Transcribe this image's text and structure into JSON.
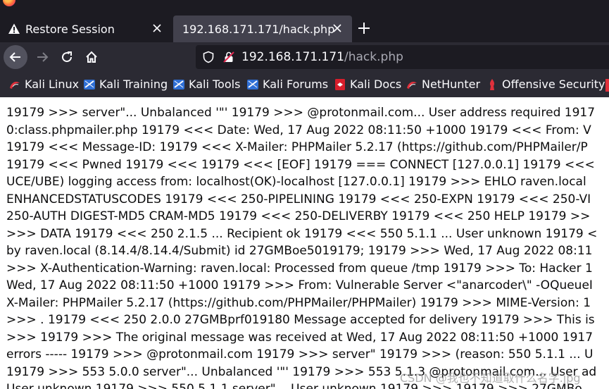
{
  "tabs": [
    {
      "label": "Restore Session",
      "icon": "warning-icon",
      "active": false
    },
    {
      "label": "192.168.171.171/hack.php",
      "active": true
    }
  ],
  "nav": {
    "url_host": "192.168.171.171",
    "url_path": "/hack.php"
  },
  "bookmarks": [
    {
      "label": "Kali Linux",
      "icon": "kali-linux-icon"
    },
    {
      "label": "Kali Training",
      "icon": "kali-training-icon"
    },
    {
      "label": "Kali Tools",
      "icon": "kali-tools-icon"
    },
    {
      "label": "Kali Forums",
      "icon": "kali-forums-icon"
    },
    {
      "label": "Kali Docs",
      "icon": "kali-docs-icon"
    },
    {
      "label": "NetHunter",
      "icon": "nethunter-icon"
    },
    {
      "label": "Offensive Security",
      "icon": "offensive-security-icon"
    }
  ],
  "content": {
    "lines": [
      "19179 >>> server\"... Unbalanced '\"' 19179 >>> @protonmail.com... User address required 1917",
      "0:class.phpmailer.php 19179 <<< Date: Wed, 17 Aug 2022 08:11:50 +1000 19179 <<< From: V",
      "19179 <<< Message-ID: 19179 <<< X-Mailer: PHPMailer 5.2.17 (https://github.com/PHPMailer/P",
      "19179 <<< Pwned 19179 <<< 19179 <<< [EOF] 19179 === CONNECT [127.0.0.1] 19179 <<<",
      "UCE/UBE) logging access from: localhost(OK)-localhost [127.0.0.1] 19179 >>> EHLO raven.local",
      "ENHANCEDSTATUSCODES 19179 <<< 250-PIPELINING 19179 <<< 250-EXPN 19179 <<< 250-VI",
      "250-AUTH DIGEST-MD5 CRAM-MD5 19179 <<< 250-DELIVERBY 19179 <<< 250 HELP 19179 >>",
      ">>> DATA 19179 <<< 250 2.1.5 ... Recipient ok 19179 <<< 550 5.1.1 ... User unknown 19179 <",
      "by raven.local (8.14.4/8.14.4/Submit) id 27GMBoe5019179; 19179 >>> Wed, 17 Aug 2022 08:11",
      ">>> X-Authentication-Warning: raven.local: Processed from queue /tmp 19179 >>> To: Hacker 1",
      "Wed, 17 Aug 2022 08:11:50 +1000 19179 >>> From: Vulnerable Server <\"anarcoder\\\" -OQueueI",
      "X-Mailer: PHPMailer 5.2.17 (https://github.com/PHPMailer/PHPMailer) 19179 >>> MIME-Version: 1",
      ">>> . 19179 <<< 250 2.0.0 27GMBprf019180 Message accepted for delivery 19179 >>> This is",
      ">>> 19179 >>> The original message was received at Wed, 17 Aug 2022 08:11:50 +1000 1917",
      "errors ----- 19179 >>> @protonmail.com 19179 >>> server\" 19179 >>> (reason: 550 5.1.1 ... U",
      "19179 >>> 553 5.0.0 server\"... Unbalanced '\"' 19179 >>> 553 5.1.3 @protonmail.com... User ad",
      "User unknown 19179 >>> 550 5.1.1 server\"... User unknown 19179 >>> 19179 >>> 27GMBo"
    ]
  },
  "watermark": "CSDN @我也不知道取什么名字.jpg"
}
